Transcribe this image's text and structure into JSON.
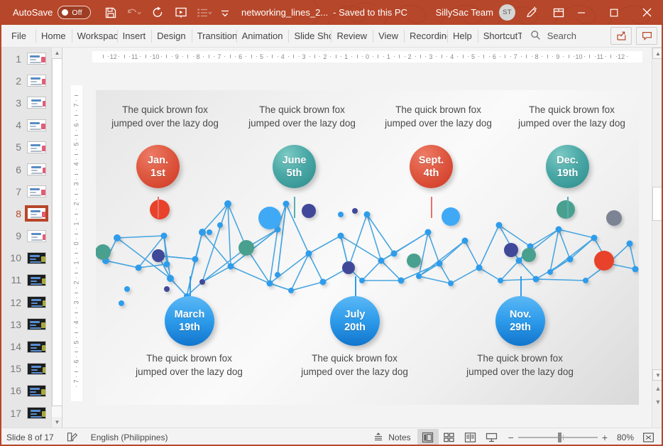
{
  "titlebar": {
    "autosave_label": "AutoSave",
    "autosave_state": "Off",
    "document_title": "networking_lines_2...",
    "save_state": "-  Saved to this PC",
    "team_name": "SillySac Team",
    "avatar_initials": "ST",
    "quick_access": [
      {
        "name": "save-icon",
        "label": "Save"
      },
      {
        "name": "undo-icon",
        "label": "Undo"
      },
      {
        "name": "redo-icon",
        "label": "Redo"
      },
      {
        "name": "start-presentation-icon",
        "label": "Start From Beginning"
      },
      {
        "name": "bullets-icon",
        "label": "Bullets"
      },
      {
        "name": "customize-qat-icon",
        "label": "Customize Quick Access Toolbar"
      }
    ],
    "window_buttons": [
      {
        "name": "minimize-button",
        "glyph": "─"
      },
      {
        "name": "maximize-button",
        "glyph": "☐"
      },
      {
        "name": "close-button",
        "glyph": "✕"
      }
    ],
    "ribbon_display_icon": "ribbon-display-options-icon",
    "pen_icon": "pen-annotation-icon"
  },
  "ribbon": {
    "tabs": [
      {
        "label": "File",
        "name": "tab-file"
      },
      {
        "label": "Home",
        "name": "tab-home"
      },
      {
        "label": "Workspac",
        "name": "tab-workspace"
      },
      {
        "label": "Insert",
        "name": "tab-insert"
      },
      {
        "label": "Design",
        "name": "tab-design"
      },
      {
        "label": "Transition",
        "name": "tab-transitions"
      },
      {
        "label": "Animation",
        "name": "tab-animations"
      },
      {
        "label": "Slide Shov",
        "name": "tab-slide-show"
      },
      {
        "label": "Review",
        "name": "tab-review"
      },
      {
        "label": "View",
        "name": "tab-view"
      },
      {
        "label": "Recording",
        "name": "tab-recording"
      },
      {
        "label": "Help",
        "name": "tab-help"
      },
      {
        "label": "ShortcutTo",
        "name": "tab-shortcuttools"
      }
    ],
    "search_placeholder": "Search",
    "share_label": "share-icon",
    "comments_label": "comments-icon"
  },
  "thumbnails": {
    "active_index": 8,
    "slides": [
      {
        "number": "1",
        "style": "light"
      },
      {
        "number": "2",
        "style": "light"
      },
      {
        "number": "3",
        "style": "light"
      },
      {
        "number": "4",
        "style": "light"
      },
      {
        "number": "5",
        "style": "light"
      },
      {
        "number": "6",
        "style": "light"
      },
      {
        "number": "7",
        "style": "light"
      },
      {
        "number": "8",
        "style": "light"
      },
      {
        "number": "9",
        "style": "light"
      },
      {
        "number": "10",
        "style": "dark"
      },
      {
        "number": "11",
        "style": "dark"
      },
      {
        "number": "12",
        "style": "dark"
      },
      {
        "number": "13",
        "style": "dark"
      },
      {
        "number": "14",
        "style": "dark"
      },
      {
        "number": "15",
        "style": "dark"
      },
      {
        "number": "16",
        "style": "dark"
      },
      {
        "number": "17",
        "style": "dark"
      }
    ]
  },
  "rulers": {
    "horizontal_labels": [
      "12",
      "11",
      "10",
      "9",
      "8",
      "7",
      "6",
      "5",
      "4",
      "3",
      "2",
      "1",
      "0",
      "1",
      "2",
      "3",
      "4",
      "5",
      "6",
      "7",
      "8",
      "9",
      "10",
      "11",
      "12"
    ],
    "vertical_labels": [
      "7",
      "6",
      "5",
      "4",
      "3",
      "2",
      "1",
      "0",
      "1",
      "2",
      "3",
      "4",
      "5",
      "6",
      "7"
    ]
  },
  "slide": {
    "body_text": "The quick brown fox jumped over the lazy dog",
    "top_texts": [
      "The quick brown fox jumped over the lazy dog",
      "The quick brown fox jumped over the lazy dog",
      "The quick brown fox jumped over the lazy dog",
      "The quick brown fox jumped over the lazy dog"
    ],
    "bottom_texts": [
      "The quick brown fox jumped over the lazy dog",
      "The quick brown fox jumped over the lazy dog",
      "The quick brown fox jumped over the lazy dog"
    ],
    "milestones_top": [
      {
        "line1": "Jan.",
        "line2": "1st",
        "color": "red",
        "hex": "#e05c44"
      },
      {
        "line1": "June",
        "line2": "5th",
        "color": "teal",
        "hex": "#4aa9a6"
      },
      {
        "line1": "Sept.",
        "line2": "4th",
        "color": "red",
        "hex": "#e05c44"
      },
      {
        "line1": "Dec.",
        "line2": "19th",
        "color": "teal",
        "hex": "#4aa9a6"
      }
    ],
    "milestones_bottom": [
      {
        "line1": "March",
        "line2": "19th",
        "color": "blue",
        "hex": "#2f9ceb"
      },
      {
        "line1": "July",
        "line2": "20th",
        "color": "blue",
        "hex": "#2f9ceb"
      },
      {
        "line1": "Nov.",
        "line2": "29th",
        "color": "blue",
        "hex": "#2f9ceb"
      }
    ],
    "graphic_name": "network-lines-graphic",
    "palette": {
      "link": "#3aa0e0",
      "node_blue": "#2f9ceb",
      "node_lightblue": "#3fa9f5",
      "node_navy": "#414899",
      "node_teal": "#4aa08f",
      "node_red": "#e8432c",
      "node_gray": "#7b8494"
    }
  },
  "statusbar": {
    "slide_counter": "Slide 8 of 17",
    "accessibility_icon": "accessibility-checker-icon",
    "language": "English (Philippines)",
    "notes_label": "Notes",
    "views": [
      {
        "name": "normal-view-button",
        "label": "Normal",
        "active": true
      },
      {
        "name": "slide-sorter-button",
        "label": "Slide Sorter",
        "active": false
      },
      {
        "name": "reading-view-button",
        "label": "Reading View",
        "active": false
      },
      {
        "name": "slide-show-button",
        "label": "Slide Show",
        "active": false
      }
    ],
    "zoom_out_label": "−",
    "zoom_in_label": "+",
    "zoom_level": "80%",
    "fit_icon": "fit-slide-to-window-icon"
  }
}
